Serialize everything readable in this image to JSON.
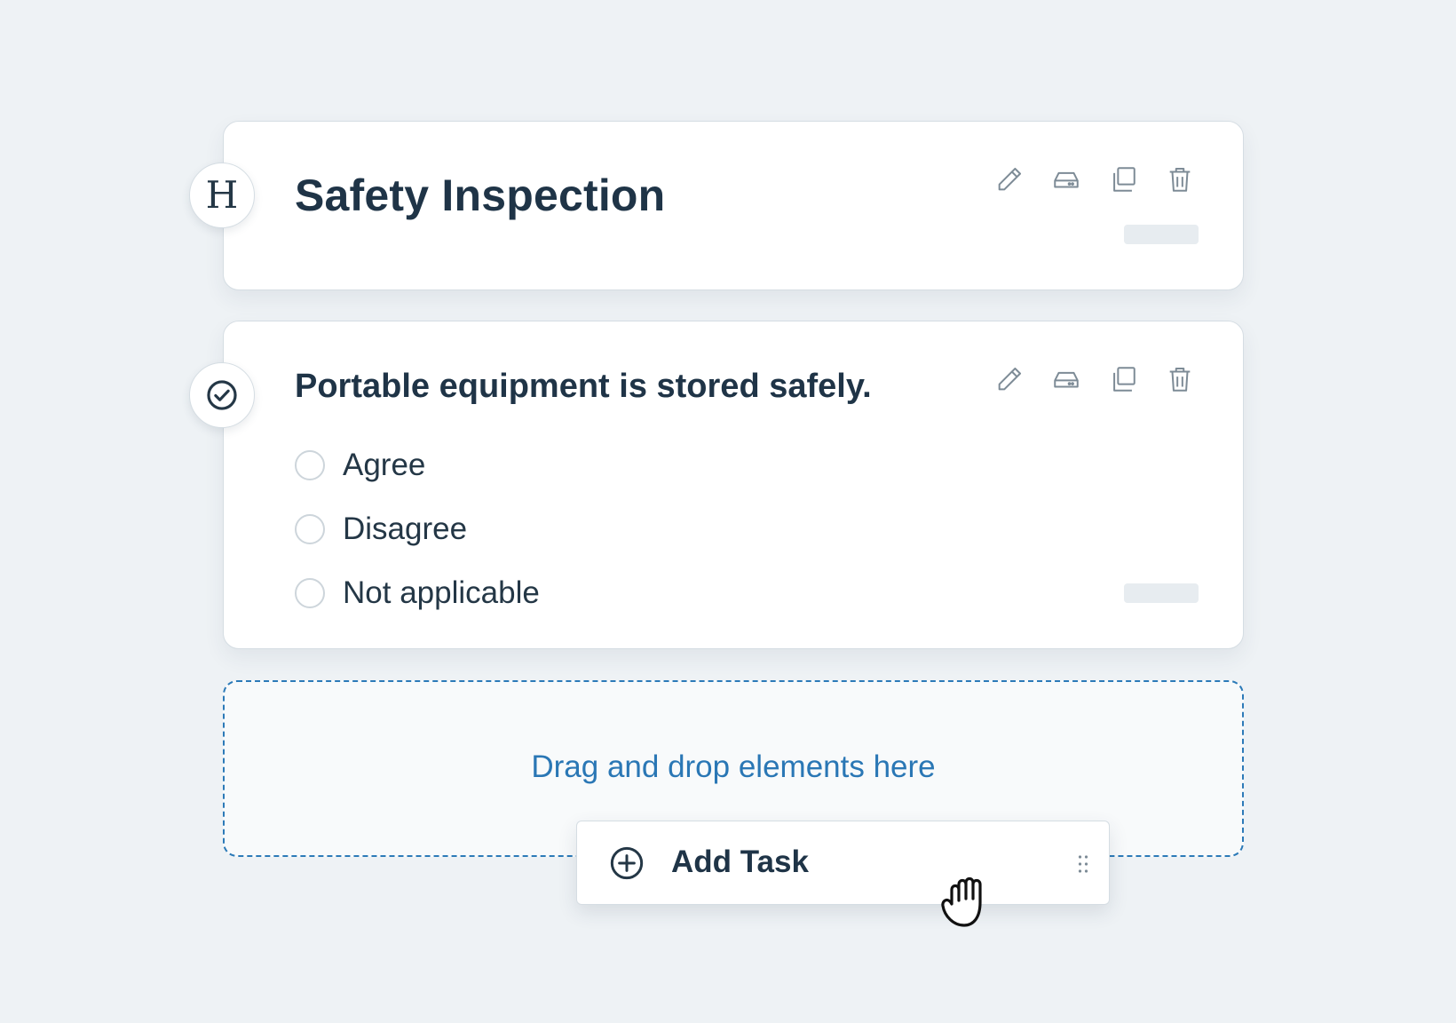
{
  "heading_card": {
    "badge_letter": "H",
    "title": "Safety Inspection",
    "actions": [
      {
        "name": "edit",
        "icon": "pencil-icon"
      },
      {
        "name": "inbox",
        "icon": "tray-icon"
      },
      {
        "name": "duplicate",
        "icon": "copy-icon"
      },
      {
        "name": "delete",
        "icon": "trash-icon"
      }
    ]
  },
  "question_card": {
    "badge_icon": "check-circle-icon",
    "question": "Portable equipment is stored safely.",
    "options": [
      "Agree",
      "Disagree",
      "Not applicable"
    ],
    "actions": [
      {
        "name": "edit",
        "icon": "pencil-icon"
      },
      {
        "name": "inbox",
        "icon": "tray-icon"
      },
      {
        "name": "duplicate",
        "icon": "copy-icon"
      },
      {
        "name": "delete",
        "icon": "trash-icon"
      }
    ]
  },
  "dropzone": {
    "text": "Drag and drop elements here"
  },
  "dragged_item": {
    "icon": "plus-circle-icon",
    "label": "Add Task",
    "handle_icon": "drag-handle-icon"
  },
  "cursor": {
    "icon": "grab-hand-icon"
  },
  "colors": {
    "background": "#eef2f5",
    "text": "#1f3447",
    "accent": "#2a77b5",
    "icon": "#7d8b96"
  }
}
